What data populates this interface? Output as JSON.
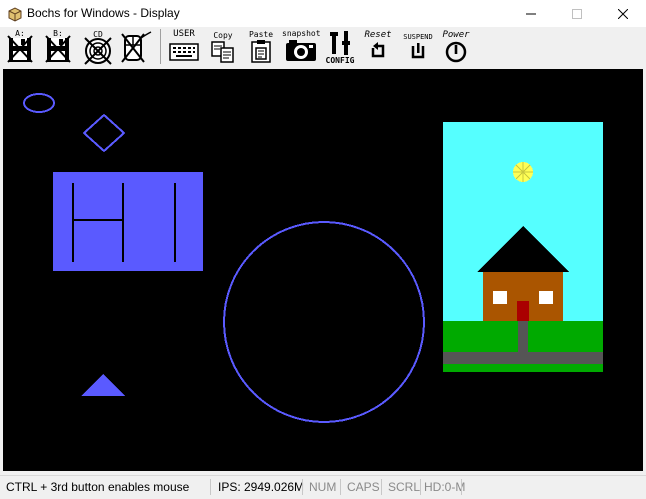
{
  "window": {
    "title": "Bochs for Windows - Display",
    "minimize_symbol": "—",
    "maximize_symbol": "☐",
    "close_symbol": "✕"
  },
  "toolbar": {
    "floppy_a_label": "A:",
    "floppy_b_label": "B:",
    "cdrom_label": "CD",
    "user_label": "USER",
    "copy_label": "Copy",
    "paste_label": "Paste",
    "snapshot_label": "snapshot",
    "config_label": "CONFIG",
    "reset_label": "Reset",
    "suspend_label": "SUSPEND",
    "power_label": "Power"
  },
  "statusbar": {
    "mouse_hint": "CTRL + 3rd button enables mouse",
    "ips": "IPS: 2949.026M",
    "num": "NUM",
    "caps": "CAPS",
    "scrl": "SCRL",
    "hd": "HD:0-M"
  },
  "colors": {
    "shape_blue": "#5a5aff",
    "sky": "#55ffff",
    "grass": "#00aa00",
    "road": "#555555",
    "roof": "#000000",
    "wall": "#aa5500",
    "door": "#aa0000",
    "sun": "#ffff55",
    "window": "#ffffff"
  },
  "display": {
    "hi_text": "HI"
  }
}
